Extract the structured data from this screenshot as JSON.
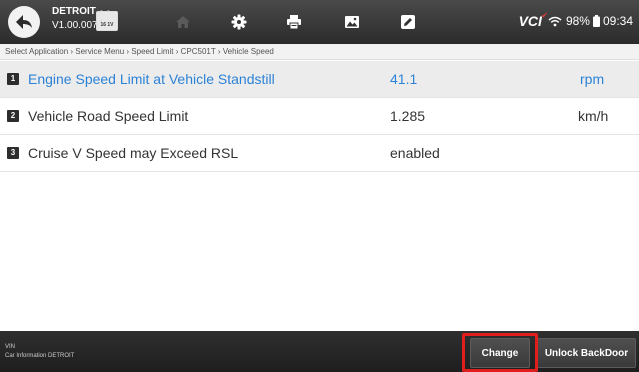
{
  "header": {
    "app_name": "DETROIT",
    "app_version": "V1.00.007",
    "badge_text": "16 1V",
    "vci_label": "VCI",
    "battery_text": "98%",
    "time": "09:34",
    "icons": [
      "back-arrow-icon",
      "home-icon",
      "settings-gear-icon",
      "print-icon",
      "image-icon",
      "edit-icon",
      "wifi-icon",
      "battery-icon"
    ]
  },
  "breadcrumb": "Select Application › Service Menu › Speed Limit › CPC501T › Vehicle Speed",
  "rows": [
    {
      "index": "1",
      "name": "Engine Speed Limit at Vehicle Standstill",
      "value": "41.1",
      "unit": "rpm",
      "selected": true
    },
    {
      "index": "2",
      "name": "Vehicle Road Speed Limit",
      "value": "1.285",
      "unit": "km/h",
      "selected": false
    },
    {
      "index": "3",
      "name": "Cruise V Speed may Exceed RSL",
      "value": "enabled",
      "unit": "",
      "selected": false
    }
  ],
  "footer": {
    "vin_label": "VIN",
    "car_info": "Car Information  DETROIT",
    "change_label": "Change",
    "unlock_label": "Unlock BackDoor"
  },
  "colors": {
    "topbar": "#333333",
    "selected_text": "#2c82d6",
    "highlight_box": "#e01e1e"
  }
}
